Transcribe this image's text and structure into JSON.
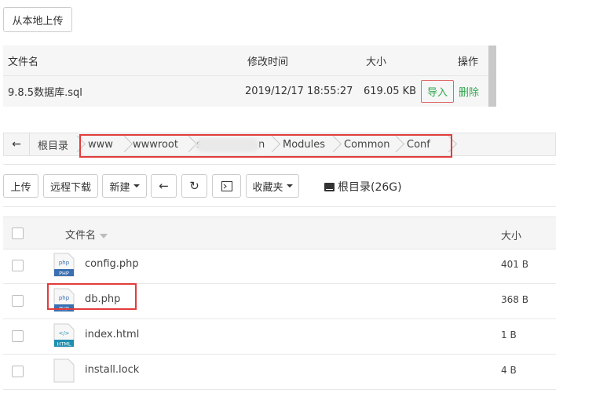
{
  "upload_local_label": "从本地上传",
  "import_table": {
    "headers": {
      "name": "文件名",
      "mtime": "修改时间",
      "size": "大小",
      "ops": "操作"
    },
    "row": {
      "name": "9.8.5数据库.sql",
      "mtime": "2019/12/17 18:55:27",
      "size": "619.05 KB",
      "import": "导入",
      "delete": "删除"
    }
  },
  "breadcrumb": {
    "root": "根目录",
    "items": [
      "www",
      "wwwroot",
      "s",
      "n",
      "Modules",
      "Common",
      "Conf"
    ]
  },
  "toolbar": {
    "upload": "上传",
    "remote_download": "远程下载",
    "new": "新建",
    "favorites": "收藏夹",
    "root_info": "根目录(26G)"
  },
  "file_table": {
    "headers": {
      "name": "文件名",
      "size": "大小"
    },
    "rows": [
      {
        "name": "config.php",
        "size": "401 B",
        "icon": "php-file-icon",
        "icon_label": "PHP",
        "icon_glyph": "php"
      },
      {
        "name": "db.php",
        "size": "368 B",
        "icon": "php-file-icon",
        "icon_label": "PHP",
        "icon_glyph": "php"
      },
      {
        "name": "index.html",
        "size": "1 B",
        "icon": "html-file-icon",
        "icon_label": "HTML",
        "icon_glyph": "</>"
      },
      {
        "name": "install.lock",
        "size": "4 B",
        "icon": "generic-file-icon",
        "icon_label": "",
        "icon_glyph": ""
      }
    ]
  },
  "colors": {
    "highlight_red": "#e23c3c",
    "action_green": "#2fa84f",
    "php_blue": "#3a6fb0",
    "html_teal": "#1f8fb0"
  }
}
